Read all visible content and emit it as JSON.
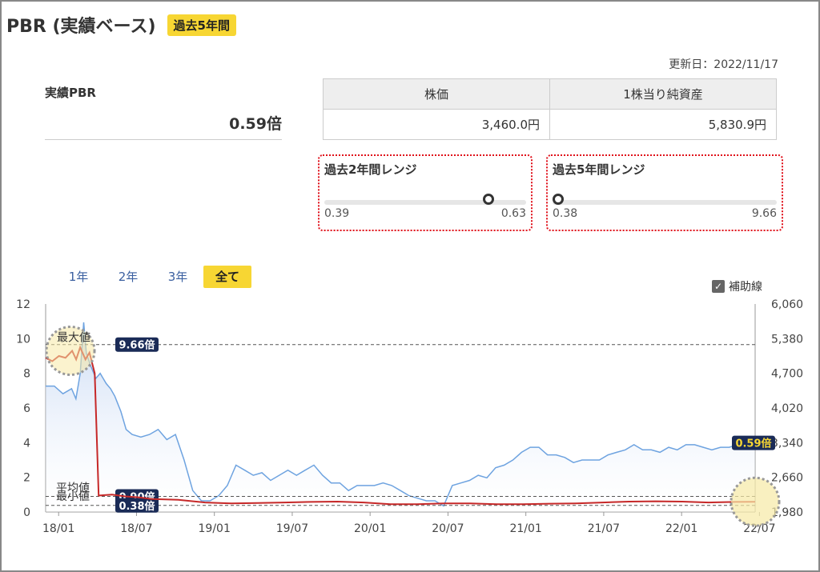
{
  "header": {
    "title": "PBR (実績ベース)",
    "badge": "過去5年間"
  },
  "updated": "更新日：2022/11/17",
  "actual": {
    "label": "実績PBR",
    "value": "0.59倍"
  },
  "price_table": {
    "headers": [
      "株価",
      "1株当り純資産"
    ],
    "values": [
      "3,460.0円",
      "5,830.9円"
    ]
  },
  "ranges": [
    {
      "title": "過去2年間レンジ",
      "min": "0.39",
      "max": "0.63",
      "position": 0.83
    },
    {
      "title": "過去5年間レンジ",
      "min": "0.38",
      "max": "9.66",
      "position": 0.0
    }
  ],
  "tabs": [
    {
      "label": "1年",
      "active": false
    },
    {
      "label": "2年",
      "active": false
    },
    {
      "label": "3年",
      "active": false
    },
    {
      "label": "全て",
      "active": true
    }
  ],
  "aux_lines": {
    "label": "補助線",
    "checked": true
  },
  "chart_data": {
    "type": "line",
    "x_ticks": [
      "18/01",
      "18/07",
      "19/01",
      "19/07",
      "20/01",
      "20/07",
      "21/01",
      "21/07",
      "22/01",
      "22/07"
    ],
    "left_axis": {
      "ticks": [
        "0",
        "2",
        "4",
        "6",
        "8",
        "10",
        "12"
      ],
      "ylim": [
        0,
        12
      ]
    },
    "right_axis": {
      "ticks": [
        "1,980",
        "2,660",
        "3,340",
        "4,020",
        "4,700",
        "5,380",
        "6,060"
      ],
      "ylim": [
        1980,
        6060
      ]
    },
    "reference_lines": [
      {
        "name": "最大値",
        "value": 9.66,
        "label": "9.66倍"
      },
      {
        "name": "平均値",
        "value": 0.9,
        "label": "0.90倍"
      },
      {
        "name": "最小値",
        "value": 0.38,
        "label": "0.38倍"
      }
    ],
    "current_label": "0.59倍",
    "series": [
      {
        "axis": "left",
        "color": "#c62828",
        "points": [
          [
            0,
            8.9
          ],
          [
            0.5,
            8.7
          ],
          [
            1,
            9.0
          ],
          [
            1.5,
            8.9
          ],
          [
            2,
            9.3
          ],
          [
            2.3,
            8.8
          ],
          [
            2.6,
            9.5
          ],
          [
            3,
            8.8
          ],
          [
            3.3,
            9.2
          ],
          [
            3.7,
            8.0
          ],
          [
            4,
            0.95
          ],
          [
            5,
            1.0
          ],
          [
            6,
            0.9
          ],
          [
            7,
            0.85
          ],
          [
            8,
            0.75
          ],
          [
            10,
            0.7
          ],
          [
            12,
            0.55
          ],
          [
            14,
            0.5
          ],
          [
            16,
            0.52
          ],
          [
            18,
            0.55
          ],
          [
            20,
            0.58
          ],
          [
            22,
            0.6
          ],
          [
            24,
            0.55
          ],
          [
            26,
            0.45
          ],
          [
            28,
            0.45
          ],
          [
            30,
            0.5
          ],
          [
            32,
            0.5
          ],
          [
            34,
            0.45
          ],
          [
            36,
            0.45
          ],
          [
            38,
            0.48
          ],
          [
            40,
            0.5
          ],
          [
            42,
            0.55
          ],
          [
            44,
            0.6
          ],
          [
            46,
            0.62
          ],
          [
            48,
            0.6
          ],
          [
            50,
            0.55
          ],
          [
            52,
            0.58
          ],
          [
            53.5,
            0.59
          ]
        ]
      },
      {
        "axis": "right",
        "color": "#6ea3e0",
        "points": [
          [
            0,
            4450
          ],
          [
            1,
            4450
          ],
          [
            2,
            4300
          ],
          [
            3,
            4400
          ],
          [
            3.5,
            4200
          ],
          [
            4,
            4700
          ],
          [
            4.4,
            5700
          ],
          [
            4.7,
            5100
          ],
          [
            5.2,
            4850
          ],
          [
            5.8,
            4600
          ],
          [
            6.3,
            4700
          ],
          [
            7,
            4500
          ],
          [
            7.5,
            4400
          ],
          [
            8,
            4250
          ],
          [
            8.7,
            3950
          ],
          [
            9.3,
            3600
          ],
          [
            10,
            3500
          ],
          [
            11,
            3450
          ],
          [
            12,
            3500
          ],
          [
            13,
            3600
          ],
          [
            14,
            3400
          ],
          [
            15,
            3500
          ],
          [
            16,
            3000
          ],
          [
            17,
            2400
          ],
          [
            18,
            2200
          ],
          [
            19,
            2200
          ],
          [
            20,
            2300
          ],
          [
            21,
            2500
          ],
          [
            22,
            2900
          ],
          [
            23,
            2800
          ],
          [
            24,
            2700
          ],
          [
            25,
            2750
          ],
          [
            26,
            2600
          ],
          [
            27,
            2700
          ],
          [
            28,
            2800
          ],
          [
            29,
            2700
          ],
          [
            30,
            2800
          ],
          [
            31,
            2900
          ],
          [
            32,
            2700
          ],
          [
            33,
            2550
          ],
          [
            34,
            2550
          ],
          [
            35,
            2400
          ],
          [
            36,
            2500
          ],
          [
            37,
            2500
          ],
          [
            38,
            2500
          ],
          [
            39,
            2550
          ],
          [
            40,
            2500
          ],
          [
            41,
            2400
          ],
          [
            42,
            2300
          ],
          [
            43,
            2250
          ],
          [
            44,
            2200
          ],
          [
            45,
            2200
          ],
          [
            46,
            2100
          ],
          [
            47,
            2500
          ],
          [
            48,
            2550
          ],
          [
            49,
            2600
          ],
          [
            50,
            2700
          ],
          [
            51,
            2650
          ],
          [
            52,
            2850
          ],
          [
            53,
            2900
          ],
          [
            54,
            3000
          ],
          [
            55,
            3150
          ],
          [
            56,
            3250
          ],
          [
            57,
            3250
          ],
          [
            58,
            3100
          ],
          [
            59,
            3100
          ],
          [
            60,
            3050
          ],
          [
            61,
            2950
          ],
          [
            62,
            3000
          ],
          [
            63,
            3000
          ],
          [
            64,
            3000
          ],
          [
            65,
            3100
          ],
          [
            66,
            3150
          ],
          [
            67,
            3200
          ],
          [
            68,
            3300
          ],
          [
            69,
            3200
          ],
          [
            70,
            3200
          ],
          [
            71,
            3150
          ],
          [
            72,
            3250
          ],
          [
            73,
            3200
          ],
          [
            74,
            3300
          ],
          [
            75,
            3300
          ],
          [
            76,
            3250
          ],
          [
            77,
            3200
          ],
          [
            78,
            3250
          ],
          [
            79,
            3250
          ],
          [
            80,
            3300
          ],
          [
            81,
            3350
          ],
          [
            82,
            3460
          ]
        ]
      }
    ]
  }
}
